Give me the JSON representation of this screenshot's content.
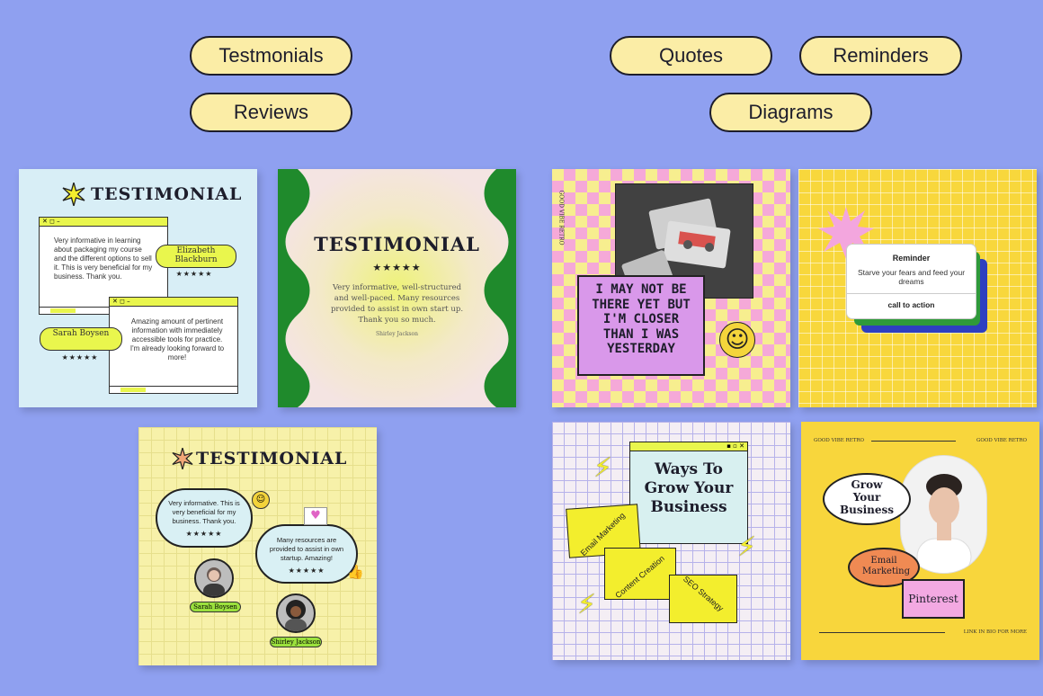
{
  "categories": {
    "testimonials": "Testmonials",
    "reviews": "Reviews",
    "quotes": "Quotes",
    "reminders": "Reminders",
    "diagrams": "Diagrams"
  },
  "card1": {
    "title": "TESTIMONIAL",
    "window_controls": "✕ ◻ –",
    "review1_text": "Very informative in learning about packaging my course and the different options to sell it. This is very beneficial for my business. Thank you.",
    "review1_name": "Elizabeth Blackburn",
    "review2_text": "Amazing amount of pertinent information with immediately accessible tools for practice. I'm already looking forward to more!",
    "review2_name": "Sarah Boysen",
    "stars": "★★★★★"
  },
  "card2": {
    "title": "TESTIMONIAL",
    "stars": "★★★★★",
    "text": "Very informative, well-structured and well-paced. Many resources provided to assist in own start up. Thank you so much.",
    "author": "Shirley Jackson"
  },
  "card3": {
    "title": "TESTIMONIAL",
    "bubble1": "Very informative. This is very beneficial for my business. Thank you.",
    "bubble2": "Many resources are provided to assist in own startup. Amazing!",
    "stars": "★★★★★",
    "name1": "Sarah Boysen",
    "name2": "Shirley Jackson"
  },
  "card4": {
    "side_text": "GOOD VIBE RETRO",
    "quote": "I MAY NOT BE THERE YET BUT I'M CLOSER THAN I WAS YESTERDAY"
  },
  "card5": {
    "heading": "Reminder",
    "text": "Starve your fears and feed your dreams",
    "cta": "call to action"
  },
  "card6": {
    "title": "Ways To Grow Your Business",
    "folder1": "Email Marketing",
    "folder2": "Content Creation",
    "folder3": "SEO Strategy"
  },
  "card7": {
    "top_left": "GOOD VIBE RETRO",
    "top_right": "GOOD VIBE RETRO",
    "bubble": "Grow Your Business",
    "email": "Email Marketing",
    "pinterest": "Pinterest",
    "footer": "LINK IN BIO FOR MORE"
  },
  "colors": {
    "background": "#8fa0f0",
    "pill": "#fbeda6",
    "lime": "#e9f64d",
    "green": "#1f8a2c",
    "pink": "#f5a9d8",
    "gold": "#f8d73c"
  }
}
